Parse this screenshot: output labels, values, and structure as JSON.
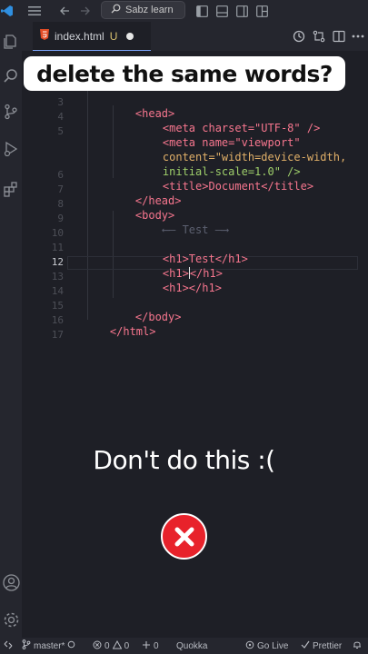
{
  "titlebar": {
    "search_text": "Sabz learn",
    "icons": [
      "vscode-logo-icon",
      "menu-icon",
      "back-arrow-icon",
      "forward-arrow-icon",
      "search-icon",
      "toggle-primary-sidebar-icon",
      "toggle-panel-icon",
      "toggle-secondary-sidebar-icon",
      "customize-layout-icon"
    ]
  },
  "activitybar": {
    "icons": [
      "explorer-icon",
      "search-icon",
      "source-control-icon",
      "run-debug-icon",
      "extensions-icon",
      "account-icon",
      "settings-gear-icon"
    ]
  },
  "tab": {
    "file_name": "index.html",
    "status": "U",
    "icon": "html5-icon",
    "actions": [
      "timeline-icon",
      "compare-icon",
      "split-editor-icon",
      "more-icon"
    ]
  },
  "caption": "delete the same words?",
  "warning": "Don't do this :(",
  "editor": {
    "active_line": "12",
    "gutter": [
      "3",
      "4",
      "5",
      "",
      "6",
      "7",
      "8",
      "9",
      "10",
      "11",
      "12",
      "13",
      "14",
      "15",
      "16",
      "17"
    ],
    "code": {
      "head_open": "<head>",
      "meta_charset": "<meta charset=\"UTF-8\" />",
      "meta_viewport": "<meta name=\"viewport\"",
      "meta_content": "content=\"width=device-width,",
      "meta_scale": "initial-scale=1.0\" />",
      "title_line": "<title>Document</title>",
      "head_close": "</head>",
      "body_open": "<body>",
      "comment": "⟵— Test —⟶",
      "h1_test": "<h1>Test</h1>",
      "h1_cursor_a": "<h1>",
      "h1_cursor_b": "</h1>",
      "h1_empty": "<h1></h1>",
      "body_close": "</body>",
      "html_close": "</html>"
    }
  },
  "statusbar": {
    "branch": "master*",
    "errors": "0",
    "warnings": "0",
    "info": "0",
    "quokka": "Quokka",
    "go_live": "Go Live",
    "prettier": "Prettier"
  },
  "colors": {
    "background": "#1e1f26",
    "tag": "#f7768e",
    "attribute": "#e0af68",
    "string": "#9ece6a",
    "x_badge": "#e8222b"
  }
}
